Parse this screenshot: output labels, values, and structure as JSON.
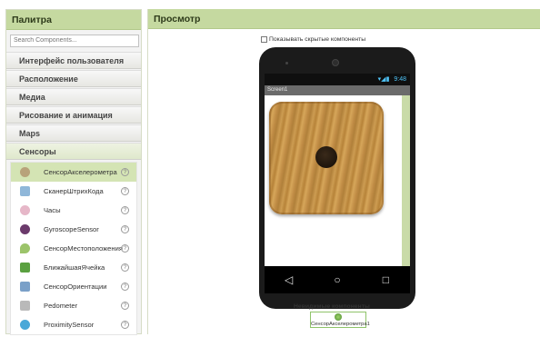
{
  "palette": {
    "title": "Палитра",
    "search_placeholder": "Search Components...",
    "categories": [
      {
        "label": "Интерфейс пользователя"
      },
      {
        "label": "Расположение"
      },
      {
        "label": "Медиа"
      },
      {
        "label": "Рисование и анимация"
      },
      {
        "label": "Maps"
      },
      {
        "label": "Сенсоры"
      }
    ],
    "sensor_items": [
      {
        "label": "СенсорАкселерометра",
        "icon": "accelerometer-icon",
        "color": "#b8a27a"
      },
      {
        "label": "СканерШтрихКода",
        "icon": "barcode-scanner-icon",
        "color": "#8fb7d9"
      },
      {
        "label": "Часы",
        "icon": "clock-icon",
        "color": "#e6b7c8"
      },
      {
        "label": "GyroscopeSensor",
        "icon": "gyroscope-icon",
        "color": "#6b3a6b"
      },
      {
        "label": "СенсорМестоположения",
        "icon": "location-sensor-icon",
        "color": "#9cc46a"
      },
      {
        "label": "БлижайшаяЯчейка",
        "icon": "nearfield-icon",
        "color": "#5aa040"
      },
      {
        "label": "СенсорОриентации",
        "icon": "orientation-sensor-icon",
        "color": "#7aa0c8"
      },
      {
        "label": "Pedometer",
        "icon": "pedometer-icon",
        "color": "#b9b9b9"
      },
      {
        "label": "ProximitySensor",
        "icon": "proximity-sensor-icon",
        "color": "#4aa8d8"
      }
    ],
    "help_glyph": "?"
  },
  "viewer": {
    "title": "Просмотр",
    "show_hidden_label": "Показывать скрытые компоненты",
    "status_time": "9:48",
    "screen_title": "Screen1",
    "nav": {
      "back": "◁",
      "home": "○",
      "recent": "□"
    },
    "invisible_label": "Невидимые компоненты",
    "invisible_component": "СенсорАкселерометра1"
  },
  "colors": {
    "header": "#c5d9a0",
    "selected": "#d4e4b4"
  }
}
